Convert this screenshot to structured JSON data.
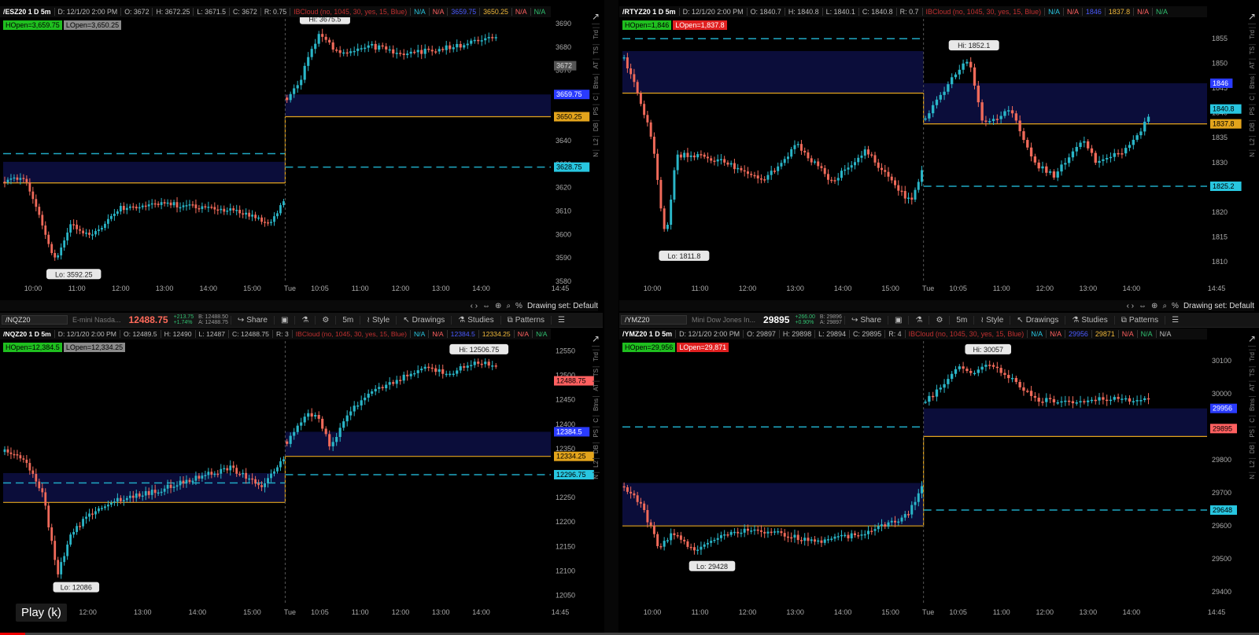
{
  "panes": [
    {
      "id": "es",
      "header": {
        "symbol": "/ESZ20 1 D 5m",
        "date": "D: 12/1/20 2:00 PM",
        "open": "O: 3672",
        "high": "H: 3672.25",
        "low": "L: 3671.5",
        "close": "C: 3672",
        "range": "R: 0.75",
        "cloud": "IBCloud (no, 1045, 30, yes, 15, Blue)",
        "f1": "N/A",
        "f2": "N/A",
        "f3": "3659.75",
        "f4": "3650.25",
        "f5": "N/A",
        "f6": "N/A"
      },
      "tags": [
        "HOpen=3,659.75",
        "LOpen=3,650.25"
      ],
      "tag_colors": [
        "g",
        "gy"
      ],
      "y_ticks": [
        "3690",
        "3680",
        "3670",
        "3660",
        "3650",
        "3640",
        "3630",
        "3620",
        "3610",
        "3600",
        "3590",
        "3580"
      ],
      "y_range": [
        3580,
        3692
      ],
      "x_ticks": [
        "10:00",
        "11:00",
        "12:00",
        "13:00",
        "14:00",
        "15:00",
        "Tue",
        "10:05",
        "11:00",
        "12:00",
        "13:00",
        "14:00",
        "14:45"
      ],
      "hi_label": "Hi: 3675.5",
      "lo_label": "Lo: 3592.25",
      "price_tags": [
        {
          "text": "3672",
          "value": 3672,
          "color": "#555555",
          "fg": "#ddd"
        },
        {
          "text": "3659.75",
          "value": 3659.75,
          "color": "#2a3bff",
          "fg": "#fff"
        },
        {
          "text": "3650.25",
          "value": 3650.25,
          "color": "#e3a41c",
          "fg": "#000"
        },
        {
          "text": "3628.75",
          "value": 3628.75,
          "color": "#28c6e0",
          "fg": "#000"
        }
      ],
      "levels": {
        "open_line": 3650.25,
        "dash_top": 3659.75,
        "dash_bot": 3628.75,
        "prev_box": [
          3622,
          3631
        ],
        "prev_dash": 3634.5,
        "prev_line": 3622,
        "today_box": [
          3650.25,
          3659.75
        ]
      },
      "bottom": {
        "drawing_set": "Drawing set: Default"
      }
    },
    {
      "id": "rty",
      "header": {
        "symbol": "/RTYZ20 1 D 5m",
        "date": "D: 12/1/20 2:00 PM",
        "open": "O: 1840.7",
        "high": "H: 1840.8",
        "low": "L: 1840.1",
        "close": "C: 1840.8",
        "range": "R: 0.7",
        "cloud": "IBCloud (no, 1045, 30, yes, 15, Blue)",
        "f1": "N/A",
        "f2": "N/A",
        "f3": "1846",
        "f4": "1837.8",
        "f5": "N/A",
        "f6": "N/A"
      },
      "tags": [
        "HOpen=1,846",
        "LOpen=1,837.8"
      ],
      "tag_colors": [
        "g",
        "r"
      ],
      "y_ticks": [
        "1855",
        "1850",
        "1845",
        "1840",
        "1835",
        "1830",
        "1825",
        "1820",
        "1815",
        "1810"
      ],
      "y_range": [
        1806,
        1859
      ],
      "x_ticks": [
        "10:00",
        "11:00",
        "12:00",
        "13:00",
        "14:00",
        "15:00",
        "Tue",
        "10:05",
        "11:00",
        "12:00",
        "13:00",
        "14:00",
        "14:45"
      ],
      "hi_label": "Hi: 1852.1",
      "lo_label": "Lo: 1811.8",
      "price_tags": [
        {
          "text": "1846",
          "value": 1846,
          "color": "#2a3bff",
          "fg": "#fff"
        },
        {
          "text": "1840.8",
          "value": 1840.8,
          "color": "#28c6e0",
          "fg": "#000"
        },
        {
          "text": "1837.8",
          "value": 1837.8,
          "color": "#e3a41c",
          "fg": "#000"
        },
        {
          "text": "1825.2",
          "value": 1825.2,
          "color": "#28c6e0",
          "fg": "#000"
        }
      ],
      "levels": {
        "open_line": 1837.8,
        "dash_top": 1846,
        "dash_bot": 1825.2,
        "prev_box": [
          1844,
          1852.5
        ],
        "prev_dash": 1855,
        "prev_line": 1844,
        "today_box": [
          1837.8,
          1846
        ]
      },
      "bottom": {
        "drawing_set": "Drawing set: Default"
      }
    },
    {
      "id": "nq",
      "toolbar": {
        "symbol": "/NQZ20",
        "desc": "E-mini Nasda...",
        "price": "12488.75",
        "chg1": "+213.75",
        "chg2": "+1.74%",
        "bid": "B: 12488.50",
        "ask": "A: 12488.75",
        "share": "Share",
        "interval": "5m",
        "style": "Style",
        "drawings": "Drawings",
        "studies": "Studies",
        "patterns": "Patterns"
      },
      "header": {
        "symbol": "/NQZ20 1 D 5m",
        "date": "D: 12/1/20 2:00 PM",
        "open": "O: 12489.5",
        "high": "H: 12490",
        "low": "L: 12487",
        "close": "C: 12488.75",
        "range": "R: 3",
        "cloud": "IBCloud (no, 1045, 30, yes, 15, Blue)",
        "f1": "N/A",
        "f2": "N/A",
        "f3": "12384.5",
        "f4": "12334.25",
        "f5": "N/A",
        "f6": "N/A"
      },
      "tags": [
        "HOpen=12,384.5",
        "LOpen=12,334.25"
      ],
      "tag_colors": [
        "g",
        "gy"
      ],
      "y_ticks": [
        "12550",
        "12500",
        "12450",
        "12400",
        "12350",
        "12300",
        "12250",
        "12200",
        "12150",
        "12100",
        "12050"
      ],
      "y_range": [
        12030,
        12570
      ],
      "x_ticks": [
        "11:00",
        "12:00",
        "13:00",
        "14:00",
        "15:00",
        "Tue",
        "10:05",
        "11:00",
        "12:00",
        "13:00",
        "14:00",
        "14:45"
      ],
      "hi_label": "Hi: 12506.75",
      "lo_label": "Lo: 12086",
      "price_tags": [
        {
          "text": "12488.75",
          "value": 12488.75,
          "color": "#ff6060",
          "fg": "#000"
        },
        {
          "text": "12384.5",
          "value": 12384.5,
          "color": "#2a3bff",
          "fg": "#fff"
        },
        {
          "text": "12334.25",
          "value": 12334.25,
          "color": "#e3a41c",
          "fg": "#000"
        },
        {
          "text": "12296.75",
          "value": 12296.75,
          "color": "#28c6e0",
          "fg": "#000"
        }
      ],
      "levels": {
        "open_line": 12334.25,
        "dash_top": 12384.5,
        "dash_bot": 12296.75,
        "prev_box": [
          12240,
          12300
        ],
        "prev_dash": 12280,
        "prev_line": 12240,
        "today_box": [
          12334.25,
          12384.5
        ]
      },
      "bottom": null
    },
    {
      "id": "ym",
      "toolbar": {
        "symbol": "/YMZ20",
        "desc": "Mini Dow Jones In...",
        "price": "29895",
        "chg1": "+266.00",
        "chg2": "+0.90%",
        "bid": "B: 29896",
        "ask": "A: 29897",
        "share": "Share",
        "interval": "5m",
        "style": "Style",
        "drawings": "Drawings",
        "studies": "Studies",
        "patterns": "Patterns"
      },
      "header": {
        "symbol": "/YMZ20 1 D 5m",
        "date": "D: 12/1/20 2:00 PM",
        "open": "O: 29897",
        "high": "H: 29898",
        "low": "L: 29894",
        "close": "C: 29895",
        "range": "R: 4",
        "cloud": "IBCloud (no, 1045, 30, yes, 15, Blue)",
        "f1": "N/A",
        "f2": "N/A",
        "f3": "29956",
        "f4": "29871",
        "f5": "N/A",
        "f6": "N/A",
        "f7": "N/A"
      },
      "tags": [
        "HOpen=29,956",
        "LOpen=29,871"
      ],
      "tag_colors": [
        "g",
        "r"
      ],
      "y_ticks": [
        "30100",
        "30000",
        "29900",
        "29800",
        "29700",
        "29600",
        "29500",
        "29400"
      ],
      "y_range": [
        29360,
        30160
      ],
      "x_ticks": [
        "10:00",
        "11:00",
        "12:00",
        "13:00",
        "14:00",
        "15:00",
        "Tue",
        "10:05",
        "11:00",
        "12:00",
        "13:00",
        "14:00",
        "14:45"
      ],
      "hi_label": "Hi: 30057",
      "lo_label": "Lo: 29428",
      "price_tags": [
        {
          "text": "29956",
          "value": 29956,
          "color": "#2a3bff",
          "fg": "#fff"
        },
        {
          "text": "29895",
          "value": 29895,
          "color": "#ff6060",
          "fg": "#000"
        },
        {
          "text": "29648",
          "value": 29648,
          "color": "#28c6e0",
          "fg": "#000"
        }
      ],
      "levels": {
        "open_line": 29871,
        "dash_top": 29900,
        "dash_bot": 29648,
        "prev_box": [
          29600,
          29730
        ],
        "prev_dash": 29900,
        "prev_line": 29600,
        "today_box": [
          29871,
          29956
        ]
      },
      "bottom": null
    }
  ],
  "side_tabs": [
    "Trd",
    "TS",
    "AT",
    "Btns",
    "C",
    "PS",
    "DB",
    "L2",
    "N"
  ],
  "play_label": "Play (k)",
  "video_progress": 0.02,
  "colors": {
    "up": "#2ab6c8",
    "down": "#f06a5a",
    "gold": "#e3a41c",
    "dash": "#1fa9c4",
    "cloud": "#0b0d3a"
  }
}
